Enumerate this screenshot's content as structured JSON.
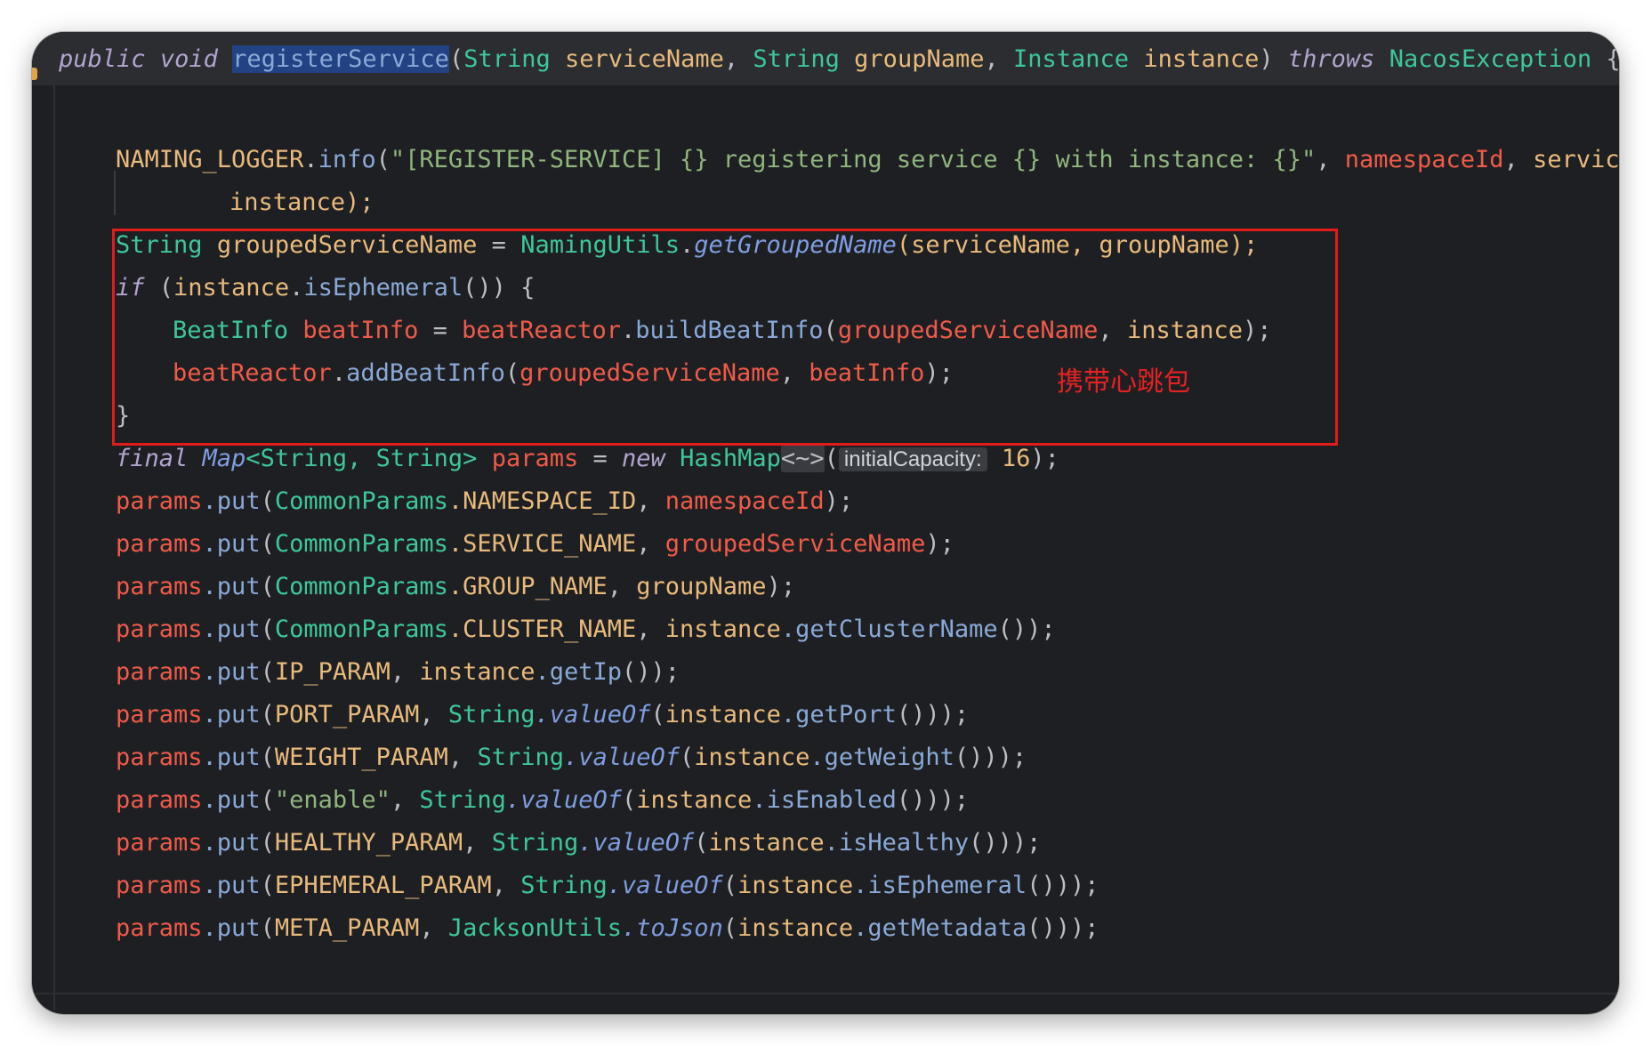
{
  "header": {
    "kw_public": "public",
    "kw_void": "void",
    "method_name": "registerService",
    "open_paren": "(",
    "p1_type": "String",
    "p1_name": "serviceName",
    "comma1": ", ",
    "p2_type": "String",
    "p2_name": "groupName",
    "comma2": ", ",
    "p3_type": "Instance",
    "p3_name": "instance",
    "close_paren": ")",
    "kw_throws": "throws",
    "exception": "NacosException",
    "brace": "{"
  },
  "code": {
    "l1": {
      "logger": "NAMING_LOGGER",
      "dot": ".",
      "method": "info",
      "open": "(",
      "string": "\"[REGISTER-SERVICE] {} registering service {} with instance: {}\"",
      "comma": ", ",
      "arg1": "namespaceId",
      "comma2": ", ",
      "arg2": "serviceN"
    },
    "l2": {
      "text": "instance);"
    },
    "l3": {
      "type": "String",
      "var": "groupedServiceName",
      "eq": " = ",
      "cls": "NamingUtils",
      "dot": ".",
      "method": "getGroupedName",
      "args": "(serviceName, groupName);"
    },
    "l4": {
      "kw": "if",
      "open": " (",
      "obj": "instance",
      "dot": ".",
      "method": "isEphemeral",
      "rest": "()) {"
    },
    "l5": {
      "type": "BeatInfo",
      "var": "beatInfo",
      "eq": " = ",
      "field": "beatReactor",
      "dot": ".",
      "method": "buildBeatInfo",
      "open": "(",
      "arg1": "groupedServiceName",
      "comma": ", ",
      "arg2": "instance",
      "close": ");"
    },
    "l6": {
      "field": "beatReactor",
      "dot": ".",
      "method": "addBeatInfo",
      "open": "(",
      "arg1": "groupedServiceName",
      "comma": ", ",
      "arg2": "beatInfo",
      "close": ");"
    },
    "l7": {
      "text": "}"
    },
    "l8": {
      "kw_final": "final",
      "type_map": "Map",
      "generic": "<String, String>",
      "var": "params",
      "eq": " = ",
      "kw_new": "new",
      "cls": "HashMap",
      "diamond": "<~>",
      "open": "(",
      "hint": "initialCapacity:",
      "num": "16",
      "close": ");"
    },
    "params_lines": [
      {
        "key_type": "CommonParams",
        "key_const": ".NAMESPACE_ID",
        "sep": ", ",
        "val_pre": "",
        "val_main": "namespaceId",
        "val_method": "",
        "val_post": ");"
      },
      {
        "key_type": "CommonParams",
        "key_const": ".SERVICE_NAME",
        "sep": ", ",
        "val_pre": "",
        "val_main": "groupedServiceName",
        "val_method": "",
        "val_post": ");"
      },
      {
        "key_type": "CommonParams",
        "key_const": ".GROUP_NAME",
        "sep": ", ",
        "val_pre": "",
        "val_main": "groupName",
        "val_method": "",
        "val_post": ");"
      },
      {
        "key_type": "CommonParams",
        "key_const": ".CLUSTER_NAME",
        "sep": ", ",
        "val_pre": "",
        "val_main": "instance",
        "val_method": ".getClusterName",
        "val_post": "());"
      }
    ],
    "params_lines2": [
      {
        "const": "IP_PARAM",
        "inner": "instance",
        "inner_method": ".getIp",
        "close": "());"
      },
      {
        "const": "PORT_PARAM",
        "inner": "instance",
        "inner_method": ".getPort",
        "close": "()));"
      },
      {
        "const": "WEIGHT_PARAM",
        "inner": "instance",
        "inner_method": ".getWeight",
        "close": "()));"
      },
      {
        "const": "\"enable\"",
        "inner": "instance",
        "inner_method": ".isEnabled",
        "close": "()));"
      },
      {
        "const": "HEALTHY_PARAM",
        "inner": "instance",
        "inner_method": ".isHealthy",
        "close": "()));"
      },
      {
        "const": "EPHEMERAL_PARAM",
        "inner": "instance",
        "inner_method": ".isEphemeral",
        "close": "()));"
      },
      {
        "const": "META_PARAM",
        "inner": "instance",
        "inner_method": ".getMetadata",
        "close": "()));"
      }
    ],
    "params_var": "params",
    "put": ".put",
    "open": "(",
    "string_cls": "String",
    "value_of": ".valueOf",
    "jackson_cls": "JacksonUtils",
    "to_json": ".toJson"
  },
  "annotation": {
    "text": "携带心跳包"
  },
  "colors": {
    "background": "#1e1f22",
    "header_bg": "#2b2d30",
    "highlight_border": "#e21b1b",
    "annotation": "#e52222",
    "keyword": "#b3a4cf",
    "type": "#3ec79b",
    "field": "#f05b4a",
    "string": "#8fb67e",
    "method": "#8aa9d7"
  }
}
